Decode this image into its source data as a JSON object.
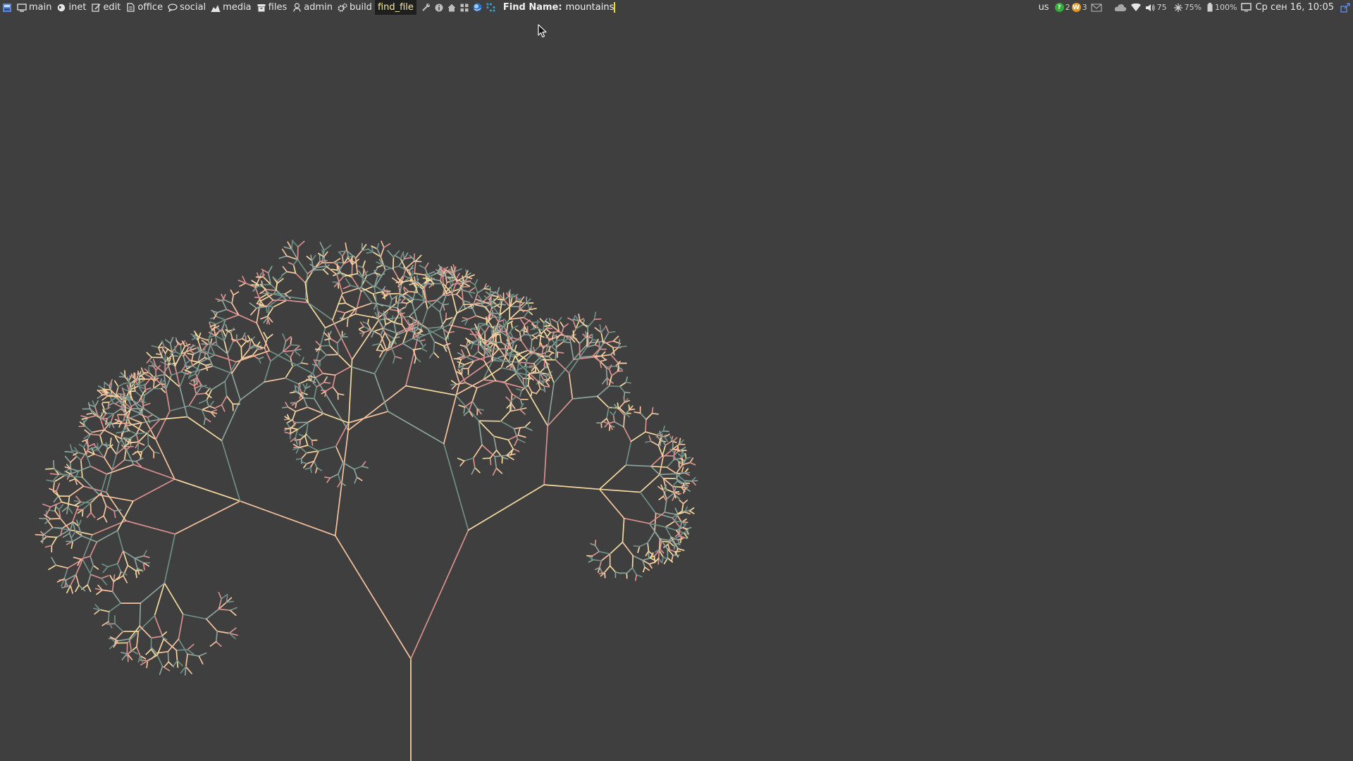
{
  "taskbar": {
    "workspaces": [
      {
        "label": "main",
        "icon": "monitor-icon",
        "active": false
      },
      {
        "label": "inet",
        "icon": "globe-icon",
        "active": false
      },
      {
        "label": "edit",
        "icon": "pencil-icon",
        "active": false
      },
      {
        "label": "office",
        "icon": "document-icon",
        "active": false
      },
      {
        "label": "social",
        "icon": "chat-bubble-icon",
        "active": false
      },
      {
        "label": "media",
        "icon": "chart-icon",
        "active": false
      },
      {
        "label": "files",
        "icon": "archive-box-icon",
        "active": false
      },
      {
        "label": "admin",
        "icon": "user-icon",
        "active": false
      },
      {
        "label": "build",
        "icon": "gears-icon",
        "active": false
      },
      {
        "label": "find_file",
        "icon": "",
        "active": true
      }
    ],
    "launchers": [
      "wrench-icon",
      "info-icon",
      "home-icon",
      "grid-icon",
      "globe-app-icon",
      "dots-app-icon"
    ],
    "prompt": {
      "label": "Find Name:",
      "value": "mountains"
    }
  },
  "tray": {
    "keyboard_layout": "us",
    "notify_green": "2",
    "notify_orange": "3",
    "volume": "75",
    "brightness": "75%",
    "battery": "100%",
    "datetime": "Ср сен 16, 10:05"
  },
  "colors": {
    "background": "#3f3f3f",
    "branch_palette": [
      "#f5d99e",
      "#6e8f86",
      "#d98f8f",
      "#f5c39e",
      "#8aa39c"
    ],
    "caret": "#f0e000"
  }
}
